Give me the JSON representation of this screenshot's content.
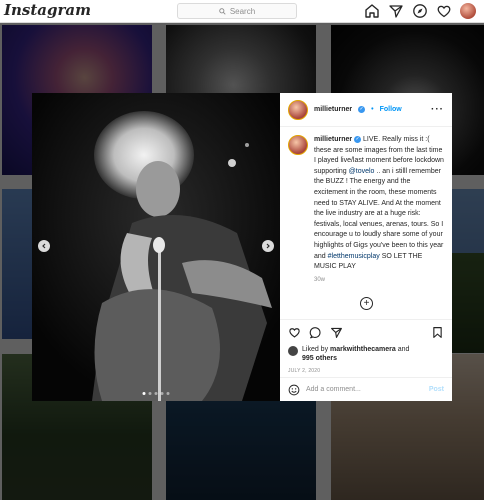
{
  "nav": {
    "logo": "Instagram",
    "search_placeholder": "Search",
    "icons": [
      "home-icon",
      "direct-icon",
      "explore-icon",
      "activity-icon",
      "profile-avatar"
    ]
  },
  "post": {
    "username": "millieturner",
    "follow_label": "Follow",
    "separator": "•",
    "caption_username": "millieturner",
    "caption_part1": "LIVE. Really miss it :( these are some images from the last time I played live/last moment before lockdown supporting ",
    "mention": "@tovelo",
    "caption_part2": " .. an i stilll remember the BUZZ ! The energy and the excitement in the room, these moments need to STAY ALIVE. And At the moment the live industry are at a huge risk: festivals, local venues, arenas, tours. So I encourage u to loudly share some of your highlights of Gigs you've been to this year and ",
    "hashtag": "#letthemusicplay",
    "caption_part3": " SO LET THE MUSIC PLAY",
    "time_ago": "30w",
    "liked_prefix": "Liked by ",
    "liked_user": "markwiththecamera",
    "liked_and": " and",
    "liked_others": "995 others",
    "date": "JULY 2, 2020",
    "comment_placeholder": "Add a comment...",
    "post_label": "Post"
  },
  "colors": {
    "accent_blue": "#0095f6",
    "link_blue": "#00376b",
    "post_disabled": "#b2dffc"
  }
}
